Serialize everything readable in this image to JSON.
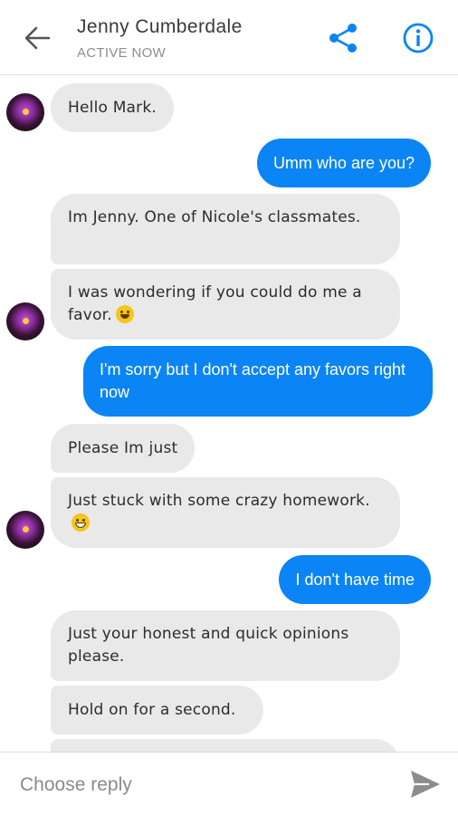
{
  "header": {
    "contact_name": "Jenny Cumberdale",
    "status": "ACTIVE NOW",
    "icons": [
      "back-arrow-icon",
      "share-icon",
      "info-icon"
    ],
    "accent_color": "#0b84f5"
  },
  "messages": [
    {
      "from": "them",
      "text": "Hello Mark."
    },
    {
      "from": "me",
      "text": "Umm who are you?"
    },
    {
      "from": "them",
      "text": "Im Jenny. One of Nicole's classmates."
    },
    {
      "from": "them",
      "text": "I was wondering if you could do me a favor.",
      "emoji": "smile"
    },
    {
      "from": "me",
      "text": "I'm sorry but I don't accept any favors right now"
    },
    {
      "from": "them",
      "text": "Please Im just"
    },
    {
      "from": "them",
      "text": "Just stuck with some crazy homework.",
      "emoji": "grin"
    },
    {
      "from": "me",
      "text": "I don't have time"
    },
    {
      "from": "them",
      "text": "Just your honest and quick opinions please."
    },
    {
      "from": "them",
      "text": "Hold on for a second."
    }
  ],
  "composer": {
    "placeholder": "Choose reply",
    "send_icon": "send-icon"
  }
}
